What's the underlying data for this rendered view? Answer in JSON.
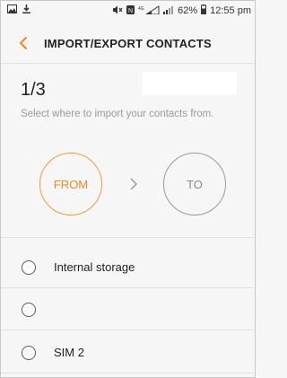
{
  "status_bar": {
    "battery_percent": "62%",
    "time": "12:55 pm"
  },
  "app_bar": {
    "title": "IMPORT/EXPORT CONTACTS"
  },
  "wizard": {
    "step": "1/3",
    "instruction": "Select where to import your contacts from.",
    "from_label": "FROM",
    "to_label": "TO"
  },
  "options": [
    {
      "label": "Internal storage"
    },
    {
      "label": ""
    },
    {
      "label": "SIM 2"
    }
  ],
  "colors": {
    "accent": "#f0892a",
    "inactive": "#8a8a8a",
    "background": "#f6f6f6"
  }
}
